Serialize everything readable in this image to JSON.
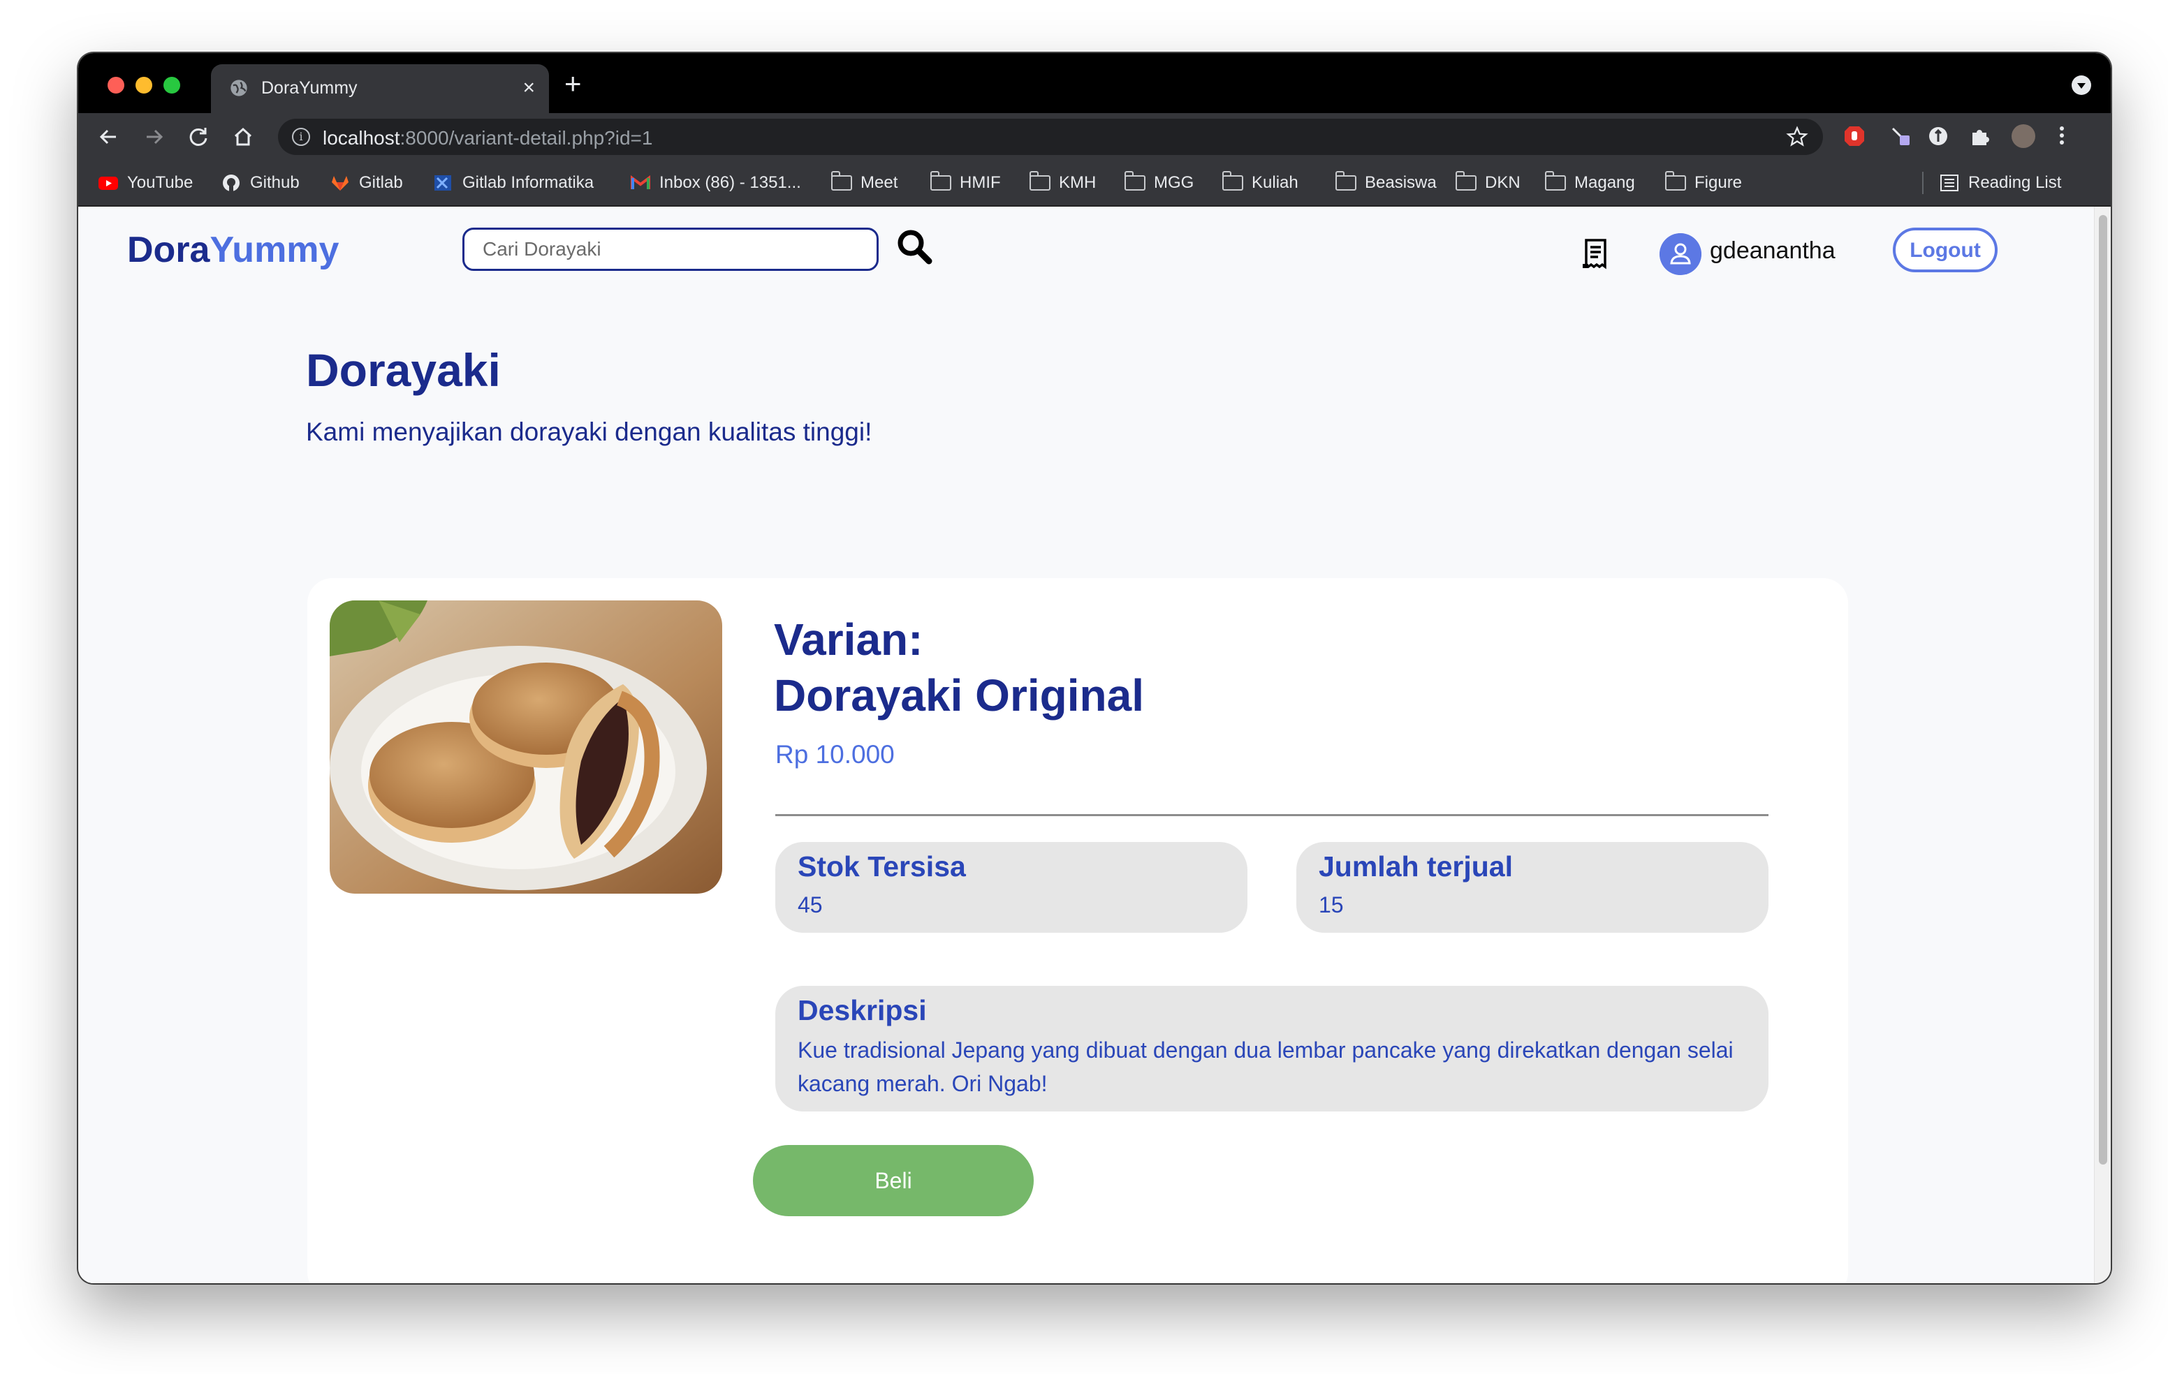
{
  "browser": {
    "tab_title": "DoraYummy",
    "tab_close": "×",
    "new_tab": "+",
    "url_host": "localhost",
    "url_path": ":8000/variant-detail.php?id=1",
    "bookmarks": [
      "YouTube",
      "Github",
      "Gitlab",
      "Gitlab Informatika",
      "Inbox (86) - 1351...",
      "Meet",
      "HMIF",
      "KMH",
      "MGG",
      "Kuliah",
      "Beasiswa",
      "DKN",
      "Magang",
      "Figure"
    ],
    "reading_list": "Reading List"
  },
  "header": {
    "logo_part1": "Dora",
    "logo_part2": "Yummy",
    "search_placeholder": "Cari Dorayaki",
    "username": "gdeanantha",
    "logout_label": "Logout"
  },
  "main": {
    "title": "Dorayaki",
    "subtitle": "Kami menyajikan dorayaki dengan kualitas tinggi!"
  },
  "product": {
    "variant_label": "Varian:",
    "name": "Dorayaki Original",
    "price": "Rp 10.000",
    "stock_label": "Stok Tersisa",
    "stock_value": "45",
    "sold_label": "Jumlah terjual",
    "sold_value": "15",
    "description_label": "Deskripsi",
    "description": "Kue tradisional Jepang yang dibuat dengan dua lembar pancake yang direkatkan dengan selai kacang merah. Ori Ngab!",
    "buy_label": "Beli"
  },
  "colors": {
    "brand_dark": "#1b2b8c",
    "brand_accent": "#4d6fe0",
    "buy_button": "#76b86a",
    "stat_background": "#e6e6e6"
  },
  "icons": [
    "globe-icon",
    "back-arrow-icon",
    "forward-arrow-icon",
    "reload-icon",
    "home-icon",
    "info-icon",
    "star-icon",
    "puzzle-icon",
    "menu-kebab-icon",
    "folder-icon",
    "search-icon",
    "receipt-icon",
    "user-icon"
  ]
}
